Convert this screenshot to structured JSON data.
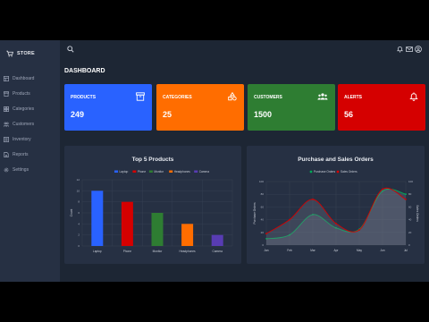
{
  "brand": {
    "name": "STORE"
  },
  "sidebar": {
    "items": [
      {
        "label": "Dashboard",
        "icon": "dashboard-icon"
      },
      {
        "label": "Products",
        "icon": "products-icon"
      },
      {
        "label": "Categories",
        "icon": "categories-icon"
      },
      {
        "label": "Customers",
        "icon": "customers-icon"
      },
      {
        "label": "Inventory",
        "icon": "inventory-icon"
      },
      {
        "label": "Reports",
        "icon": "reports-icon"
      },
      {
        "label": "Settings",
        "icon": "settings-icon"
      }
    ]
  },
  "header": {
    "icons": [
      "search-icon",
      "bell-icon",
      "mail-icon",
      "account-icon"
    ]
  },
  "page": {
    "title": "DASHBOARD"
  },
  "cards": [
    {
      "label": "PRODUCTS",
      "value": "249",
      "color": "#2962ff",
      "icon": "archive-icon"
    },
    {
      "label": "CATEGORIES",
      "value": "25",
      "color": "#ff6d00",
      "icon": "shapes-icon"
    },
    {
      "label": "CUSTOMERS",
      "value": "1500",
      "color": "#2e7d32",
      "icon": "people-icon"
    },
    {
      "label": "ALERTS",
      "value": "56",
      "color": "#d50000",
      "icon": "alert-bell-icon"
    }
  ],
  "chart_data": [
    {
      "type": "bar",
      "title": "Top 5 Products",
      "categories": [
        "Laptop",
        "Phone",
        "Monitor",
        "Headphones",
        "Camera"
      ],
      "values": [
        10,
        8,
        6,
        4,
        2
      ],
      "colors": [
        "#2962ff",
        "#d50000",
        "#2e7d32",
        "#ff6d00",
        "#583cb3"
      ],
      "legend": [
        "Laptop",
        "Phone",
        "Monitor",
        "Headphones",
        "Camera"
      ],
      "legend_position": "top",
      "ylabel": "Count",
      "ylim": [
        0,
        12
      ],
      "yticks": [
        0,
        2,
        4,
        6,
        8,
        10,
        12
      ],
      "grid": true
    },
    {
      "type": "area",
      "title": "Purchase and Sales Orders",
      "categories": [
        "Jan",
        "Feb",
        "Mar",
        "Apr",
        "May",
        "Jun",
        "Jul"
      ],
      "series": [
        {
          "name": "Purchase Orders",
          "color": "#00ab57",
          "values": [
            10,
            16,
            48,
            27,
            25,
            85,
            80
          ],
          "axis": "left"
        },
        {
          "name": "Sales Orders",
          "color": "#d50000",
          "values": [
            18,
            40,
            72,
            34,
            24,
            88,
            72
          ],
          "axis": "right"
        }
      ],
      "ylabel": "Purchase Orders",
      "y2label": "Sales Orders",
      "ylim": [
        0,
        100
      ],
      "yticks": [
        0,
        20,
        40,
        60,
        80,
        100
      ],
      "y2lim": [
        0,
        100
      ],
      "y2ticks": [
        0,
        20,
        40,
        60,
        80,
        100
      ],
      "legend_position": "top",
      "grid": true
    }
  ]
}
